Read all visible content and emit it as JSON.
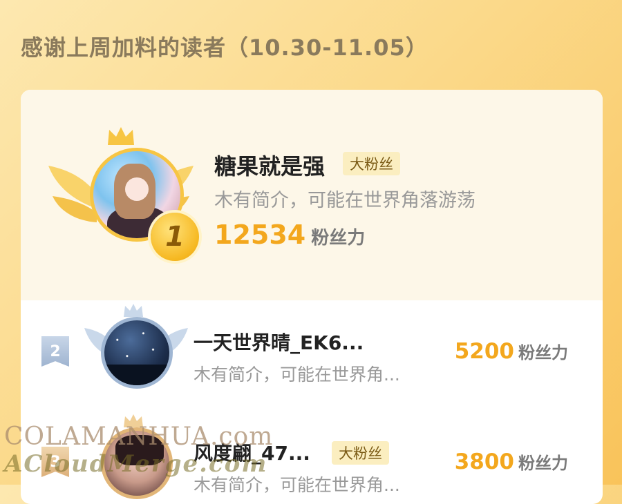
{
  "header": {
    "title": "感谢上周加料的读者（10.30-11.05）"
  },
  "readers": [
    {
      "rank": "1",
      "name": "糖果就是强",
      "badge": "大粉丝",
      "bio": "木有简介，可能在世界角落游荡",
      "score": "12534",
      "score_label": "粉丝力"
    },
    {
      "rank": "2",
      "name": "一天世界晴_EK6...",
      "badge": "",
      "bio": "木有简介，可能在世界角...",
      "score": "5200",
      "score_label": "粉丝力"
    },
    {
      "rank": "3",
      "name": "风度翩_47...",
      "badge": "大粉丝",
      "bio": "木有简介，可能在世界角...",
      "score": "3800",
      "score_label": "粉丝力"
    }
  ],
  "watermark": {
    "line1": "COLAMANHUA.com",
    "line2": "ACloudMerge.com"
  },
  "colors": {
    "accent": "#f3a71d",
    "gold": "#f7c543",
    "silver": "#9fb6d3",
    "bronze": "#e2b678"
  },
  "icons": {
    "rank1": "gold-medal-icon",
    "crown": "crown-icon",
    "wings": "wings-icon"
  }
}
